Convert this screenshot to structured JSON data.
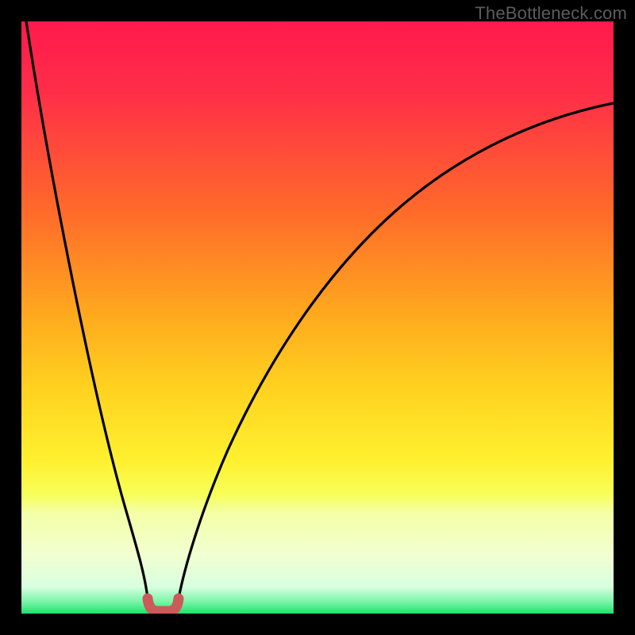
{
  "watermark": "TheBottleneck.com",
  "colors": {
    "frame": "#000000",
    "grad_top": "#ff1a4d",
    "grad_mid1": "#ff6a2a",
    "grad_mid2": "#ffd21f",
    "grad_low": "#f7ff5a",
    "grad_band": "#f4ffa8",
    "grad_green": "#1de26a",
    "curve": "#000000",
    "u_stroke": "#cc5a5a"
  },
  "chart_data": {
    "type": "line",
    "title": "",
    "xlabel": "",
    "ylabel": "",
    "xlim": [
      0,
      100
    ],
    "ylim": [
      0,
      100
    ],
    "note": "Axes are unlabeled; x and y are normalized 0–100 from left→right and bottom→top of the colored plot area. Values estimated from pixel positions.",
    "series": [
      {
        "name": "left-branch",
        "x": [
          0.8,
          3,
          5,
          7,
          9,
          11,
          13,
          15,
          17,
          18.5,
          20,
          21.3
        ],
        "y": [
          100,
          90,
          80,
          70,
          60,
          50,
          40,
          30,
          20,
          12,
          6,
          2.5
        ]
      },
      {
        "name": "right-branch",
        "x": [
          26.5,
          28,
          30,
          33,
          37,
          42,
          48,
          55,
          63,
          72,
          82,
          92,
          100
        ],
        "y": [
          2.5,
          6,
          12,
          21,
          32,
          43,
          53,
          61,
          68,
          74,
          79,
          83,
          86
        ]
      },
      {
        "name": "u-marker",
        "x": [
          21.3,
          21.5,
          22.2,
          23.9,
          25.6,
          26.3,
          26.5
        ],
        "y": [
          2.5,
          1.2,
          0.5,
          0.3,
          0.5,
          1.2,
          2.5
        ]
      }
    ],
    "gradient_stops_pct_from_top": [
      {
        "pct": 0,
        "color": "#ff1a4d"
      },
      {
        "pct": 32,
        "color": "#ff6a2a"
      },
      {
        "pct": 62,
        "color": "#ffd21f"
      },
      {
        "pct": 78,
        "color": "#f7ff5a"
      },
      {
        "pct": 85,
        "color": "#f4ffa8"
      },
      {
        "pct": 96,
        "color": "#d8ffe0"
      },
      {
        "pct": 100,
        "color": "#1de26a"
      }
    ]
  }
}
